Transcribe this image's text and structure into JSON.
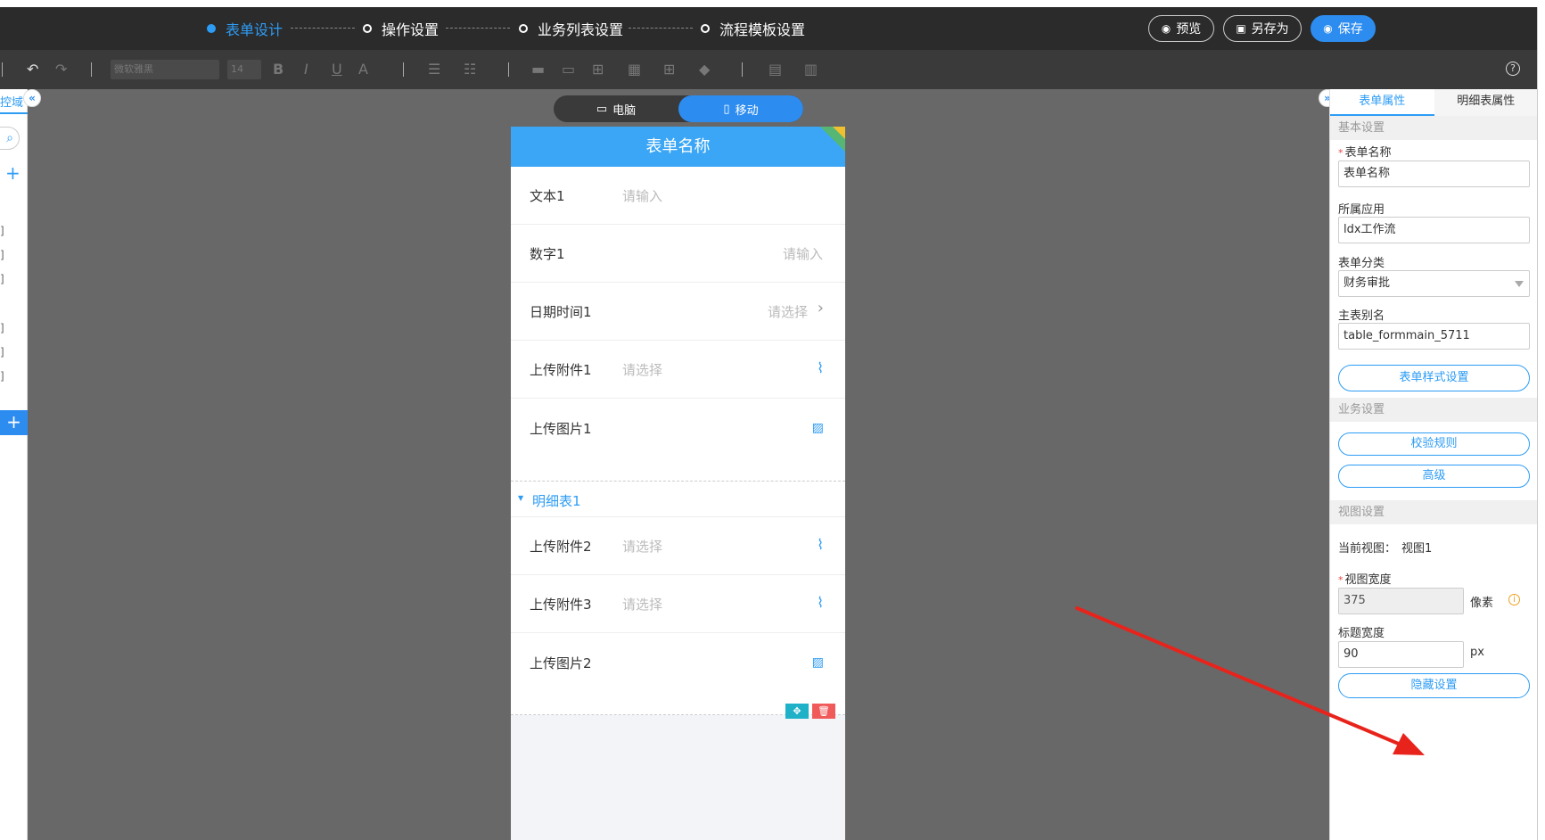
{
  "steps": [
    {
      "label": "表单设计",
      "active": true
    },
    {
      "label": "操作设置",
      "active": false
    },
    {
      "label": "业务列表设置",
      "active": false
    },
    {
      "label": "流程模板设置",
      "active": false
    }
  ],
  "header_buttons": {
    "preview": "预览",
    "save_as": "另存为",
    "save": "保存"
  },
  "toolbar": {
    "font_family": "微软雅黑",
    "font_size": "14",
    "bold": "B",
    "italic": "I",
    "underline": "U",
    "font_color": "A",
    "help": "?"
  },
  "left_panel": {
    "tab": "控域",
    "items": [
      "]",
      "]",
      "]",
      "]",
      "]",
      "]"
    ]
  },
  "device_toggle": {
    "desktop": "电脑",
    "mobile": "移动",
    "active": "mobile"
  },
  "form": {
    "title": "表单名称",
    "fields": [
      {
        "label": "文本1",
        "placeholder": "请输入"
      },
      {
        "label": "数字1",
        "placeholder": "请输入"
      },
      {
        "label": "日期时间1",
        "placeholder": "请选择"
      },
      {
        "label": "上传附件1",
        "placeholder": "请选择"
      },
      {
        "label": "上传图片1",
        "placeholder": ""
      }
    ],
    "subtable": {
      "title": "明细表1",
      "fields": [
        {
          "label": "上传附件2",
          "placeholder": "请选择"
        },
        {
          "label": "上传附件3",
          "placeholder": "请选择"
        },
        {
          "label": "上传图片2",
          "placeholder": ""
        }
      ]
    }
  },
  "right_panel": {
    "tabs": [
      "表单属性",
      "明细表属性"
    ],
    "active_tab": 0,
    "sections": {
      "basic": "基本设置",
      "business": "业务设置",
      "view": "视图设置"
    },
    "form_name_label": "表单名称",
    "form_name_value": "表单名称",
    "app_label": "所属应用",
    "app_value": "ldx工作流",
    "category_label": "表单分类",
    "category_value": "财务审批",
    "alias_label": "主表别名",
    "alias_value": "table_formmain_5711",
    "style_button": "表单样式设置",
    "rules_button": "校验规则",
    "advanced_button": "高级",
    "current_view_label": "当前视图：",
    "current_view_value": "视图1",
    "view_width_label": "视图宽度",
    "view_width_value": "375",
    "view_width_unit": "像素",
    "title_width_label": "标题宽度",
    "title_width_value": "90",
    "title_width_unit": "px",
    "hide_button": "隐藏设置"
  },
  "colors": {
    "accent": "#2d9cf5",
    "header_bg": "#2b2b2b",
    "canvas_bg": "#686868",
    "annotation_arrow": "#e8231b"
  }
}
